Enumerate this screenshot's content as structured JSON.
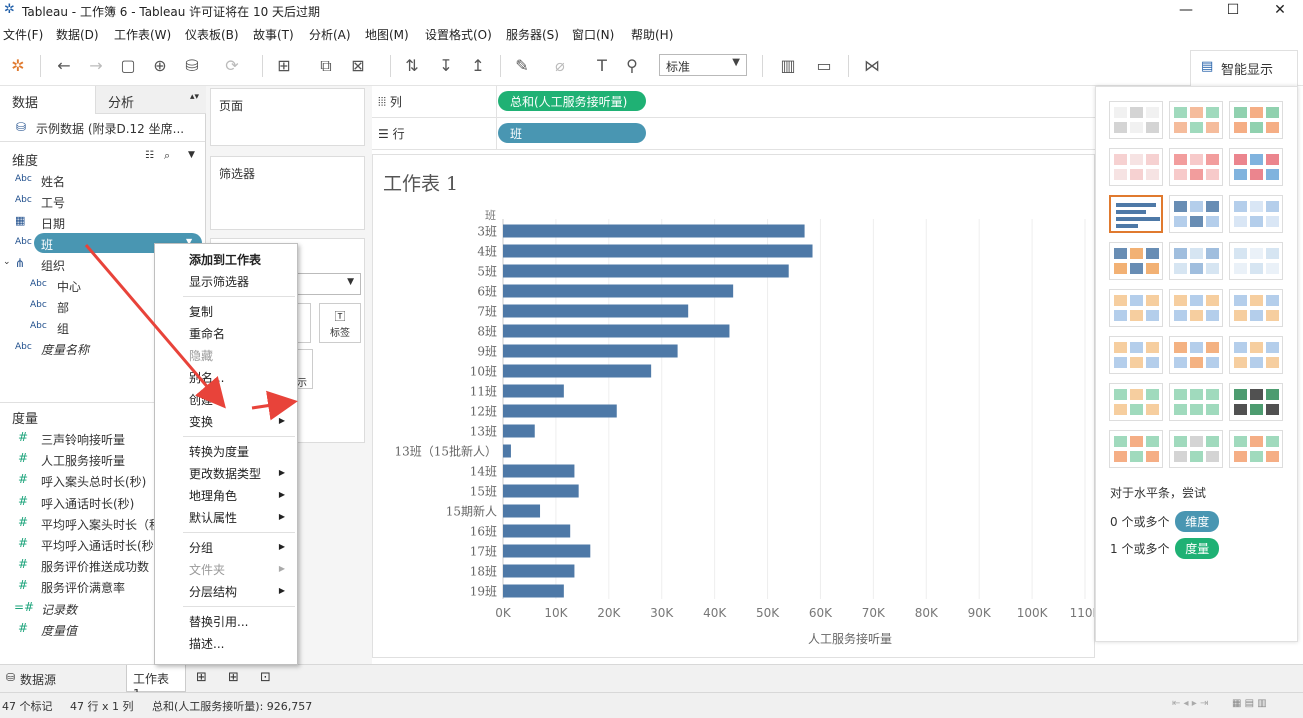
{
  "window": {
    "title": "Tableau - 工作簿 6 - Tableau 许可证将在 10 天后过期"
  },
  "menu": [
    "文件(F)",
    "数据(D)",
    "工作表(W)",
    "仪表板(B)",
    "故事(T)",
    "分析(A)",
    "地图(M)",
    "设置格式(O)",
    "服务器(S)",
    "窗口(N)",
    "帮助(H)"
  ],
  "toolbar": {
    "fit_select": "标准",
    "smart_show_tab": "智能显示"
  },
  "left_pane": {
    "tabs": [
      "数据",
      "分析"
    ],
    "datasource": "示例数据 (附录D.12 坐席...",
    "dimensions_title": "维度",
    "dimensions": [
      {
        "icon": "Abc",
        "name": "姓名"
      },
      {
        "icon": "Abc",
        "name": "工号"
      },
      {
        "icon": "date",
        "name": "日期"
      },
      {
        "icon": "Abc",
        "name": "班"
      },
      {
        "icon": "hier",
        "name": "组织"
      },
      {
        "icon": "Abc",
        "name": "中心"
      },
      {
        "icon": "Abc",
        "name": "部"
      },
      {
        "icon": "Abc",
        "name": "组"
      },
      {
        "icon": "Abc",
        "name": "度量名称"
      }
    ],
    "measures_title": "度量",
    "measures": [
      "三声铃响接听量",
      "人工服务接听量",
      "呼入案头总时长(秒)",
      "呼入通话时长(秒)",
      "平均呼入案头时长（秒",
      "平均呼入通话时长(秒)",
      "服务评价推送成功数",
      "服务评价满意率",
      "记录数",
      "度量值"
    ]
  },
  "shelves": {
    "pages": "页面",
    "filters": "筛选器",
    "columns_label": "列",
    "rows_label": "行",
    "columns_pill": "总和(人工服务接听量)",
    "rows_pill": "班",
    "marks_label_btn": "标签",
    "marks_partial": "示"
  },
  "sheet": {
    "title": "工作表 1"
  },
  "context_menu": {
    "items": [
      {
        "label": "添加到工作表",
        "bold": true
      },
      {
        "label": "显示筛选器"
      },
      {
        "sep": true
      },
      {
        "label": "复制"
      },
      {
        "label": "重命名"
      },
      {
        "label": "隐藏",
        "disabled": true
      },
      {
        "label": "别名..."
      },
      {
        "label": "创建",
        "sub": true
      },
      {
        "label": "变换",
        "sub": true
      },
      {
        "sep": true
      },
      {
        "label": "转换为度量"
      },
      {
        "label": "更改数据类型",
        "sub": true
      },
      {
        "label": "地理角色",
        "sub": true
      },
      {
        "label": "默认属性",
        "sub": true
      },
      {
        "sep": true
      },
      {
        "label": "分组",
        "sub": true
      },
      {
        "label": "文件夹",
        "sub": true,
        "disabled": true
      },
      {
        "label": "分层结构",
        "sub": true
      },
      {
        "sep": true
      },
      {
        "label": "替换引用..."
      },
      {
        "label": "描述..."
      }
    ]
  },
  "smart_show": {
    "hint": "对于水平条，尝试",
    "line1_prefix": "0 个或多个",
    "line1_pill": "维度",
    "line2_prefix": "1 个或多个",
    "line2_pill": "度量"
  },
  "bottom": {
    "datasource_tab": "数据源",
    "sheet_tab": "工作表 1"
  },
  "status": {
    "marks": "47 个标记",
    "rows_cols": "47 行 x 1 列",
    "sum": "总和(人工服务接听量): 926,757"
  },
  "colors": {
    "bar": "#4e79a7",
    "dim_pill": "#4996b2",
    "measure_pill": "#1fb174"
  },
  "chart_data": {
    "type": "bar",
    "orientation": "horizontal",
    "categories": [
      "3班",
      "4班",
      "5班",
      "6班",
      "7班",
      "8班",
      "9班",
      "10班",
      "11班",
      "12班",
      "13班",
      "13班（15批新人）",
      "14班",
      "15班",
      "15期新人",
      "16班",
      "17班",
      "18班",
      "19班"
    ],
    "values": [
      57000,
      58500,
      54000,
      43500,
      35000,
      42800,
      33000,
      28000,
      11500,
      21500,
      6000,
      1500,
      13500,
      14300,
      7000,
      12700,
      16500,
      13500,
      11500
    ],
    "xlabel": "人工服务接听量",
    "ylabel": "班",
    "xlim": [
      0,
      110000
    ],
    "x_ticks": [
      "0K",
      "10K",
      "20K",
      "30K",
      "40K",
      "50K",
      "60K",
      "70K",
      "80K",
      "90K",
      "100K",
      "110K"
    ]
  }
}
